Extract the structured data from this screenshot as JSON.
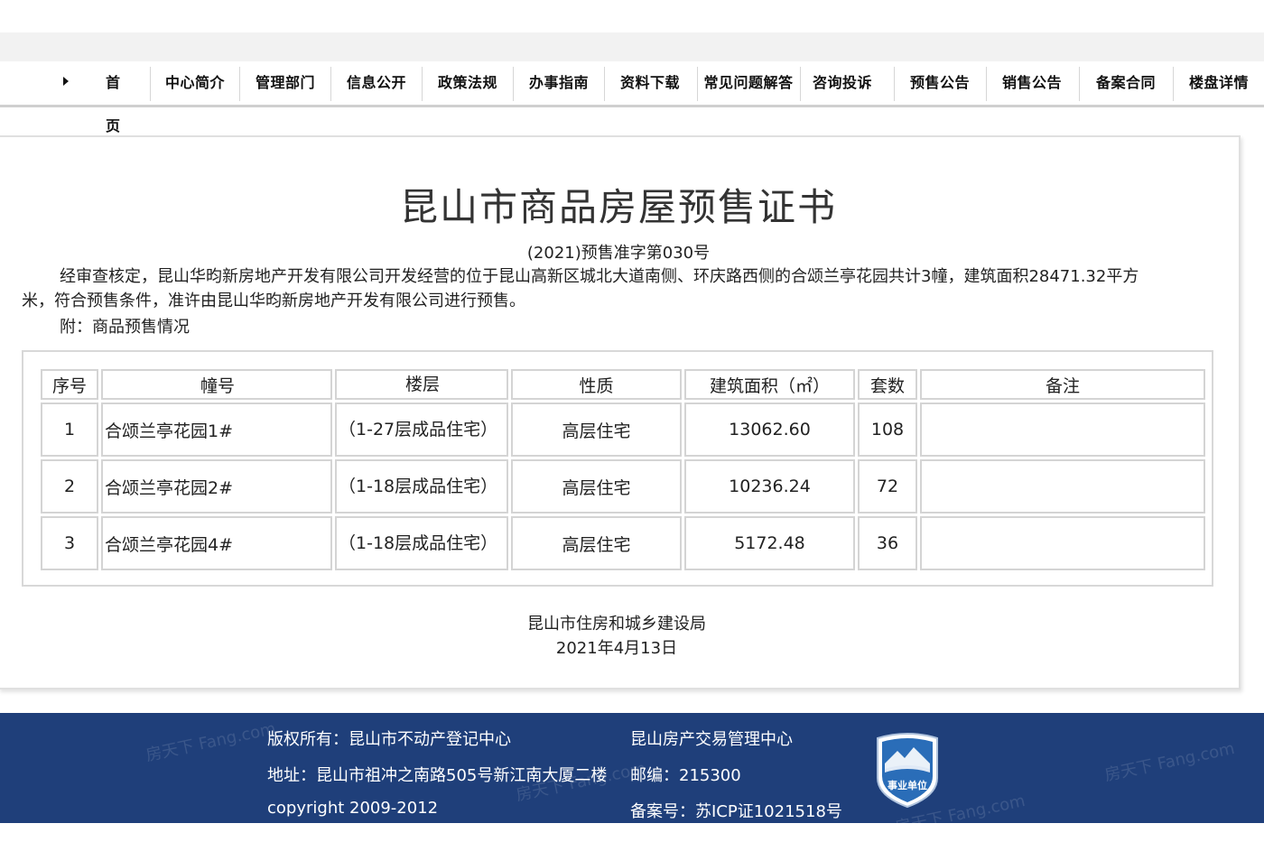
{
  "nav": {
    "items": [
      {
        "label": "首 页"
      },
      {
        "label": "中心简介"
      },
      {
        "label": "管理部门"
      },
      {
        "label": "信息公开"
      },
      {
        "label": "政策法规"
      },
      {
        "label": "办事指南"
      },
      {
        "label": "资料下载"
      },
      {
        "label": "常见问题解答"
      },
      {
        "label": "咨询投诉"
      },
      {
        "label": "预售公告"
      },
      {
        "label": "销售公告"
      },
      {
        "label": "备案合同"
      },
      {
        "label": "楼盘详情"
      }
    ]
  },
  "certificate": {
    "title": "昆山市商品房屋预售证书",
    "number": "(2021)预售准字第030号",
    "body": "经审查核定，昆山华昀新房地产开发有限公司开发经营的位于昆山高新区城北大道南侧、环庆路西侧的合颂兰亭花园共计3幢，建筑面积28471.32平方米，符合预售条件，准许由昆山华昀新房地产开发有限公司进行预售。",
    "attachment_label": "附：商品预售情况"
  },
  "table": {
    "headers": [
      "序号",
      "幢号",
      "楼层",
      "性质",
      "建筑面积（㎡）",
      "套数",
      "备注"
    ],
    "rows": [
      {
        "no": "1",
        "building": "合颂兰亭花园1#",
        "floors": "（1-27层成品住宅）",
        "type": "高层住宅",
        "area": "13062.60",
        "units": "108",
        "note": ""
      },
      {
        "no": "2",
        "building": "合颂兰亭花园2#",
        "floors": "（1-18层成品住宅）",
        "type": "高层住宅",
        "area": "10236.24",
        "units": "72",
        "note": ""
      },
      {
        "no": "3",
        "building": "合颂兰亭花园4#",
        "floors": "（1-18层成品住宅）",
        "type": "高层住宅",
        "area": "5172.48",
        "units": "36",
        "note": ""
      }
    ]
  },
  "issuer": {
    "name": "昆山市住房和城乡建设局",
    "date": "2021年4月13日"
  },
  "footer": {
    "copyright_owner": "版权所有：昆山市不动产登记中心",
    "center": "昆山房产交易管理中心",
    "address": "地址：昆山市祖冲之南路505号新江南大厦二楼",
    "postcode": "邮编：215300",
    "copyright": "copyright 2009-2012",
    "icp": "备案号：苏ICP证1021518号",
    "badge_text": "事业单位",
    "watermark": "房天下 Fang.com"
  },
  "colors": {
    "footer_bg": "#1f3f7a",
    "badge_blue": "#2a6db8"
  }
}
